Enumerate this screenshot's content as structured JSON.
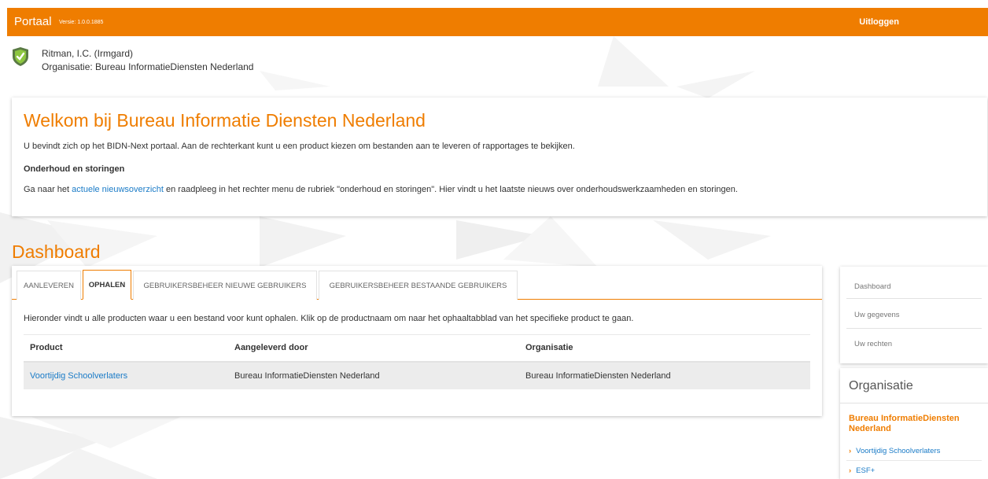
{
  "header": {
    "brand": "Portaal",
    "version": "Versie: 1.0.0.1885",
    "logout": "Uitloggen"
  },
  "user": {
    "name": "Ritman, I.C. (Irmgard)",
    "organisation": "Organisatie: Bureau InformatieDiensten Nederland"
  },
  "welcome": {
    "title": "Welkom bij Bureau Informatie Diensten Nederland",
    "intro": "U bevindt zich op het BIDN-Next portaal. Aan de rechterkant kunt u een product kiezen om bestanden aan te leveren of rapportages te bekijken.",
    "subtitle": "Onderhoud en storingen",
    "news_before": "Ga naar het ",
    "news_link": "actuele nieuwsoverzicht",
    "news_after": " en raadpleeg in het rechter menu de rubriek \"onderhoud en storingen\". Hier vindt u het laatste nieuws over onderhoudswerkzaamheden en storingen."
  },
  "dashboard": {
    "title": "Dashboard",
    "tabs": [
      {
        "label": "AANLEVEREN",
        "active": false
      },
      {
        "label": "OPHALEN",
        "active": true
      },
      {
        "label": "GEBRUIKERSBEHEER NIEUWE GEBRUIKERS",
        "active": false
      },
      {
        "label": "GEBRUIKERSBEHEER BESTAANDE GEBRUIKERS",
        "active": false
      }
    ],
    "description": "Hieronder vindt u alle producten waar u een bestand voor kunt ophalen. Klik op de productnaam om naar het ophaaltabblad van het specifieke product te gaan.",
    "table": {
      "headers": [
        "Product",
        "Aangeleverd door",
        "Organisatie"
      ],
      "rows": [
        [
          "Voortijdig Schoolverlaters",
          "Bureau InformatieDiensten Nederland",
          "Bureau InformatieDiensten Nederland"
        ]
      ]
    }
  },
  "sidebar": {
    "menu": [
      "Dashboard",
      "Uw gegevens",
      "Uw rechten"
    ],
    "organisation": {
      "title": "Organisatie",
      "name": "Bureau InformatieDiensten Nederland",
      "products": [
        "Voortijdig Schoolverlaters",
        "ESF+"
      ]
    }
  },
  "colors": {
    "accent": "#ef7d00",
    "link": "#1a7bc7",
    "shield_green": "#6ab023"
  }
}
